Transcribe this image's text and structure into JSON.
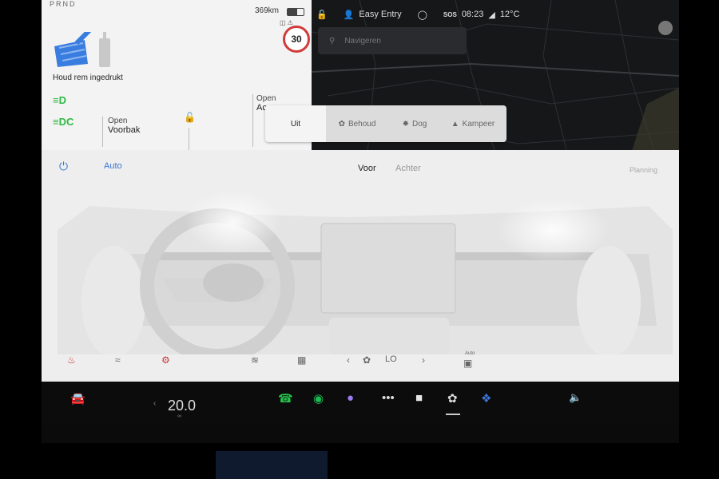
{
  "gear_selector": "PRND",
  "vehicle": {
    "range": "369km",
    "speed_limit": "30",
    "brake_label": "Houd rem ingedrukt",
    "frunk": {
      "label_top": "Open",
      "label_bottom": "Voorbak"
    },
    "trunk": {
      "label_top": "Open",
      "label_bottom": "Ac"
    }
  },
  "status_bar": {
    "profile": "Easy Entry",
    "sos": "SOS",
    "time": "08:23",
    "temperature": "12°C"
  },
  "search": {
    "placeholder": "Navigeren"
  },
  "climate_modes": [
    {
      "label": "Uit",
      "icon": "none"
    },
    {
      "label": "Behoud",
      "icon": "fan-icon"
    },
    {
      "label": "Dog",
      "icon": "paw-icon"
    },
    {
      "label": "Kampeer",
      "icon": "tent-icon"
    }
  ],
  "climate": {
    "auto_label": "Auto",
    "tab_front": "Voor",
    "tab_rear": "Achter",
    "planning": "Planning",
    "fan_level": "LO",
    "recirc_label": "Auto"
  },
  "dock": {
    "cabin_temp": "20.0",
    "dots": "•••"
  },
  "colors": {
    "accent_blue": "#3b76d6",
    "light_green": "#2fba45",
    "speed_red": "#d23b3b",
    "phone_green": "#25c14a",
    "spotify_green": "#1db954"
  }
}
